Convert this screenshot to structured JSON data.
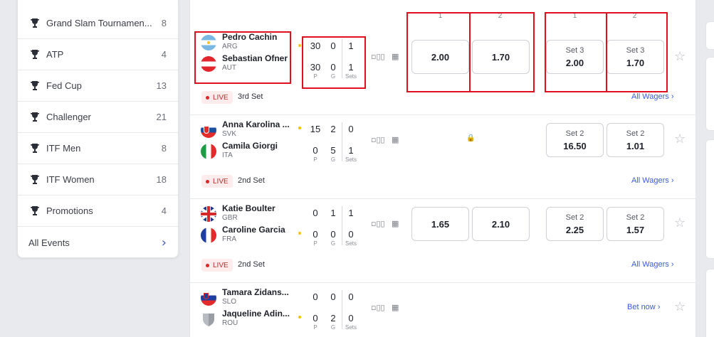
{
  "sidebar": {
    "items": [
      {
        "label": "Grand Slam Tournamen...",
        "count": "8"
      },
      {
        "label": "ATP",
        "count": "4"
      },
      {
        "label": "Fed Cup",
        "count": "13"
      },
      {
        "label": "Challenger",
        "count": "21"
      },
      {
        "label": "ITF Men",
        "count": "8"
      },
      {
        "label": "ITF Women",
        "count": "18"
      },
      {
        "label": "Promotions",
        "count": "4"
      }
    ],
    "all_events": "All Events"
  },
  "column_headers": {
    "one": "1",
    "two": "2"
  },
  "score_labels": {
    "points": "P",
    "games": "G",
    "sets": "Sets"
  },
  "matches": [
    {
      "p1": {
        "name": "Pedro Cachin",
        "country": "ARG"
      },
      "p2": {
        "name": "Sebastian Ofner",
        "country": "AUT"
      },
      "score1": {
        "p": "30",
        "g": "0",
        "s": "1"
      },
      "score2": {
        "p": "30",
        "g": "0",
        "s": "1"
      },
      "odds": [
        "2.00",
        "1.70"
      ],
      "set_odds": [
        {
          "label": "Set 3",
          "value": "2.00"
        },
        {
          "label": "Set 3",
          "value": "1.70"
        }
      ],
      "live": "LIVE",
      "set": "3rd Set",
      "wagers": "All Wagers"
    },
    {
      "p1": {
        "name": "Anna Karolina ...",
        "country": "SVK"
      },
      "p2": {
        "name": "Camila Giorgi",
        "country": "ITA"
      },
      "score1": {
        "p": "15",
        "g": "2",
        "s": "0"
      },
      "score2": {
        "p": "0",
        "g": "5",
        "s": "1"
      },
      "set_odds": [
        {
          "label": "Set 2",
          "value": "16.50"
        },
        {
          "label": "Set 2",
          "value": "1.01"
        }
      ],
      "live": "LIVE",
      "set": "2nd Set",
      "wagers": "All Wagers"
    },
    {
      "p1": {
        "name": "Katie Boulter",
        "country": "GBR"
      },
      "p2": {
        "name": "Caroline Garcia",
        "country": "FRA"
      },
      "score1": {
        "p": "0",
        "g": "1",
        "s": "1"
      },
      "score2": {
        "p": "0",
        "g": "0",
        "s": "0"
      },
      "odds": [
        "1.65",
        "2.10"
      ],
      "set_odds": [
        {
          "label": "Set 2",
          "value": "2.25"
        },
        {
          "label": "Set 2",
          "value": "1.57"
        }
      ],
      "live": "LIVE",
      "set": "2nd Set",
      "wagers": "All Wagers"
    },
    {
      "p1": {
        "name": "Tamara Zidans...",
        "country": "SLO"
      },
      "p2": {
        "name": "Jaqueline Adin...",
        "country": "ROU"
      },
      "score1": {
        "p": "0",
        "g": "0",
        "s": "0"
      },
      "score2": {
        "p": "0",
        "g": "2",
        "s": "0"
      },
      "bet_now": "Bet now"
    }
  ],
  "colors": {
    "accent": "#3a5bd9",
    "live": "#d82828",
    "highlight": "#e0101d",
    "serve": "#f2c400"
  }
}
